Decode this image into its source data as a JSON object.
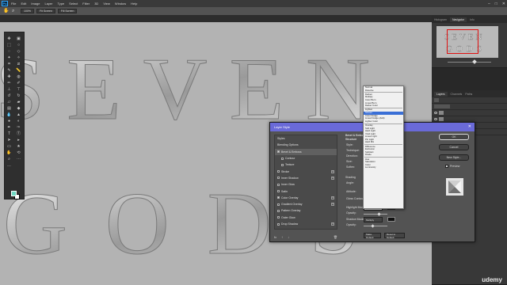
{
  "menubar": {
    "logo": "Ps",
    "items": [
      "File",
      "Edit",
      "Image",
      "Layer",
      "Type",
      "Select",
      "Filter",
      "3D",
      "View",
      "Window",
      "Help"
    ],
    "controls": [
      "–",
      "□",
      "✕"
    ]
  },
  "options_bar": {
    "zoom": "100%",
    "fit_screen": "Fit Screen",
    "fill_screen": "Fill Screen"
  },
  "canvas": {
    "text_line1": "SEVEN",
    "text_line2": "GODS"
  },
  "right_panels": {
    "top_tabs": [
      "Histogram",
      "Navigator",
      "Info"
    ],
    "layers_tabs": [
      "Layers",
      "Channels",
      "Paths"
    ]
  },
  "layer_style": {
    "title": "Layer Style",
    "styles": [
      {
        "label": "Styles",
        "checked": null,
        "plus": false,
        "sub": false
      },
      {
        "label": "Blending Options",
        "checked": null,
        "plus": false,
        "sub": false
      },
      {
        "label": "Bevel & Emboss",
        "checked": true,
        "plus": false,
        "sub": false,
        "selected": true
      },
      {
        "label": "Contour",
        "checked": false,
        "plus": false,
        "sub": true
      },
      {
        "label": "Texture",
        "checked": false,
        "plus": false,
        "sub": true
      },
      {
        "label": "Stroke",
        "checked": false,
        "plus": true,
        "sub": false
      },
      {
        "label": "Inner Shadow",
        "checked": false,
        "plus": true,
        "sub": false
      },
      {
        "label": "Inner Glow",
        "checked": false,
        "plus": false,
        "sub": false
      },
      {
        "label": "Satin",
        "checked": false,
        "plus": false,
        "sub": false
      },
      {
        "label": "Color Overlay",
        "checked": true,
        "plus": true,
        "sub": false
      },
      {
        "label": "Gradient Overlay",
        "checked": false,
        "plus": true,
        "sub": false
      },
      {
        "label": "Pattern Overlay",
        "checked": false,
        "plus": false,
        "sub": false
      },
      {
        "label": "Outer Glow",
        "checked": false,
        "plus": false,
        "sub": false
      },
      {
        "label": "Drop Shadow",
        "checked": false,
        "plus": true,
        "sub": false
      }
    ],
    "bottom_icons": [
      "fx",
      "↑",
      "↓"
    ],
    "trash_icon": "🗑",
    "props": {
      "header": "Bevel & Emboss",
      "subheader": "Structure",
      "labels": [
        "Style:",
        "Technique:",
        "Direction:",
        "Size:",
        "Soften:",
        "Shading",
        "Angle:",
        "Altitude:",
        "Gloss Contour:",
        "Highlight Mode:",
        "Opacity:",
        "Shadow Mode:",
        "Opacity:"
      ],
      "highlight_mode_value": "Screen",
      "shadow_mode_value": "Multiply",
      "make_default": "Make Default",
      "reset_default": "Reset to Default"
    },
    "buttons": {
      "ok": "OK",
      "cancel": "Cancel",
      "new_style": "New Style...",
      "preview": "Preview"
    }
  },
  "blend_modes": {
    "groups": [
      [
        "Normal",
        "Dissolve"
      ],
      [
        "Darken",
        "Multiply",
        "Color Burn",
        "Linear Burn",
        "Darker Color"
      ],
      [
        "Lighten",
        "Screen",
        "Color Dodge",
        "Linear Dodge (Add)",
        "Lighter Color"
      ],
      [
        "Overlay",
        "Soft Light",
        "Hard Light",
        "Vivid Light",
        "Linear Light",
        "Pin Light",
        "Hard Mix"
      ],
      [
        "Difference",
        "Exclusion",
        "Subtract",
        "Divide"
      ],
      [
        "Hue",
        "Saturation",
        "Color",
        "Luminosity"
      ]
    ],
    "selected": "Screen"
  },
  "watermark": "udemy",
  "colors": {
    "fg": "#6fd7c2",
    "bg": "#ffffff",
    "dialog_title": "#6a6ad8"
  }
}
